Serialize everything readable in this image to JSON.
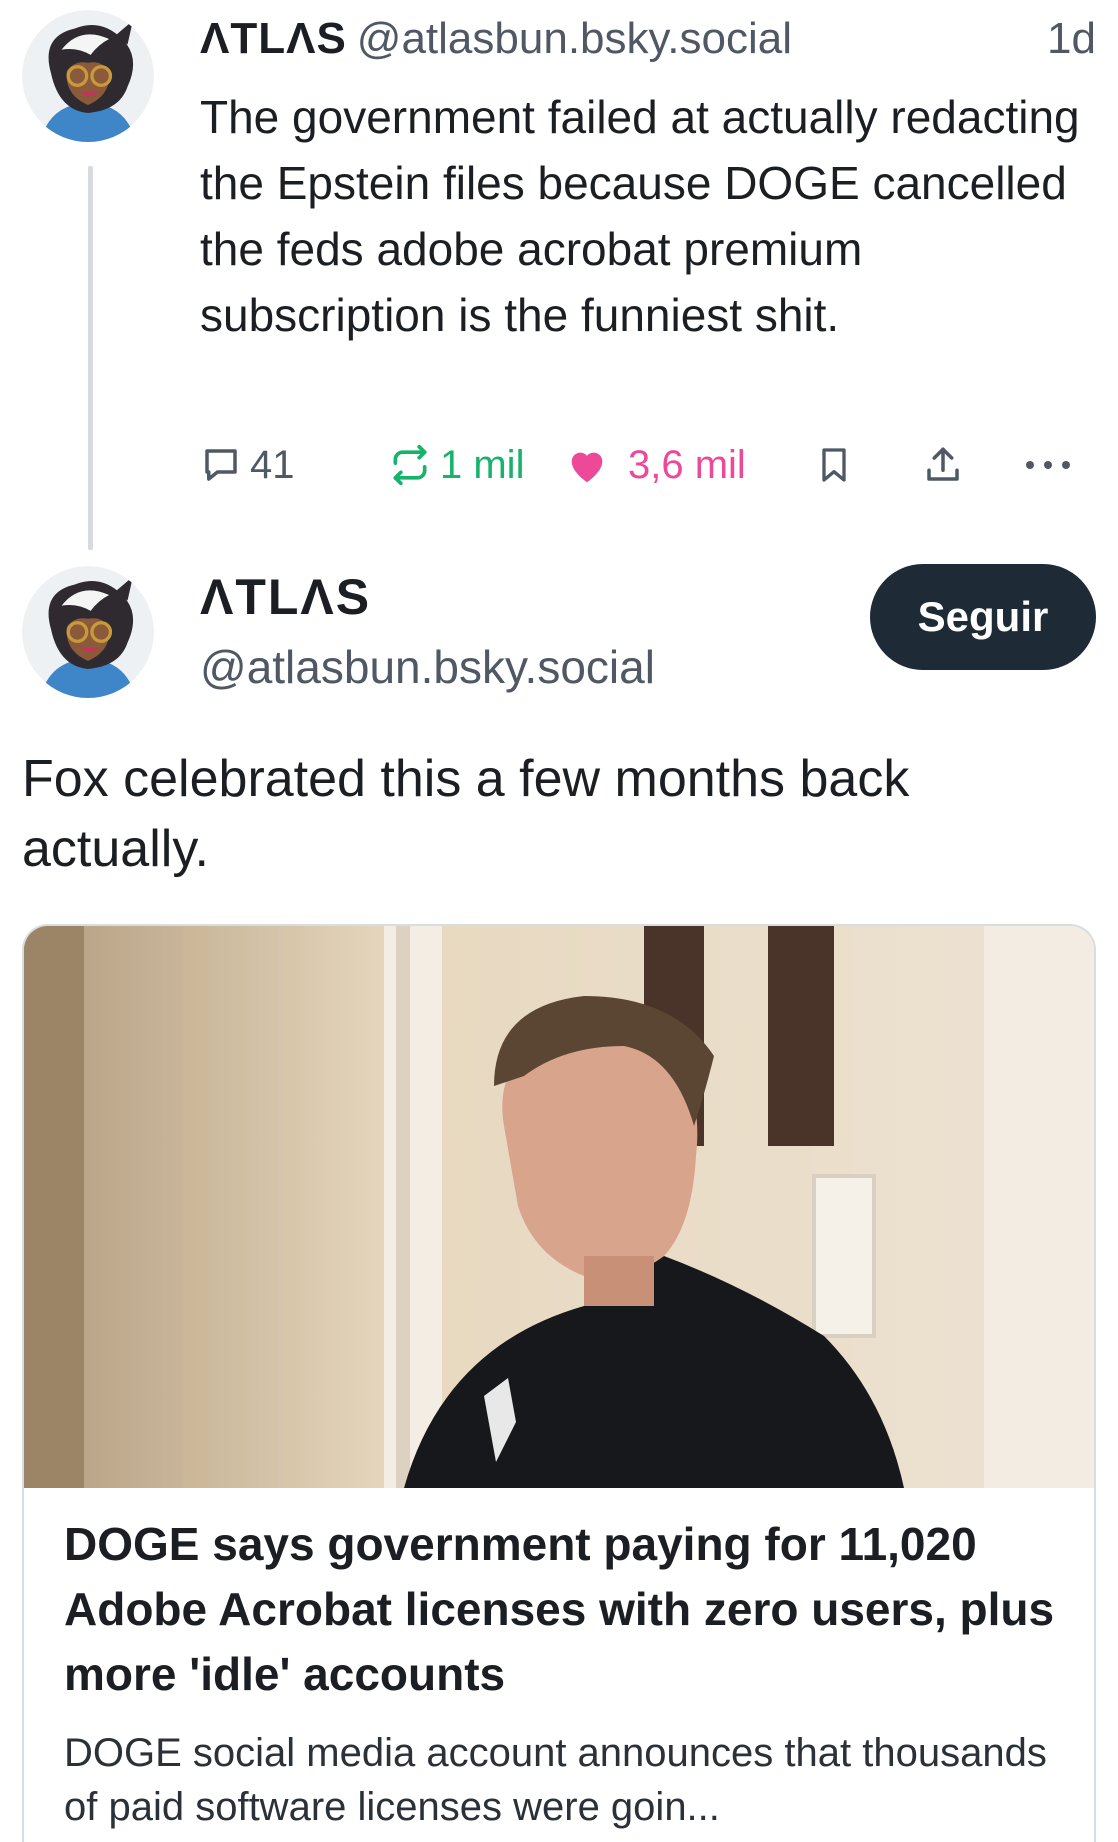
{
  "post1": {
    "display_name": "ΛTLΛS",
    "handle": "@atlasbun.bsky.social",
    "time": "1d",
    "text": "The government failed at actually redacting the Epstein files because DOGE cancelled the feds adobe acrobat premium subscription is the funniest shit.",
    "actions": {
      "replies": "41",
      "reposts": "1 mil",
      "likes": "3,6 mil",
      "reply_icon": "speech-bubble-icon",
      "repost_icon": "repost-arrows-icon",
      "like_icon": "heart-icon",
      "bookmark_icon": "bookmark-icon",
      "share_icon": "share-icon",
      "more_icon": "ellipsis-icon"
    }
  },
  "post2": {
    "display_name": "ΛTLΛS",
    "handle": "@atlasbun.bsky.social",
    "follow_label": "Seguir",
    "text": "Fox celebrated this a few months back actually."
  },
  "link_card": {
    "title": "DOGE says government paying for 11,020 Adobe Acrobat licenses with zero users, plus more 'idle' accounts",
    "description": "DOGE social media account announces that thousands of paid software licenses were goin..."
  },
  "colors": {
    "repost_green": "#17b36a",
    "like_pink": "#ec4a99",
    "muted_gray": "#4f5864",
    "follow_button": "#1e2a36"
  }
}
